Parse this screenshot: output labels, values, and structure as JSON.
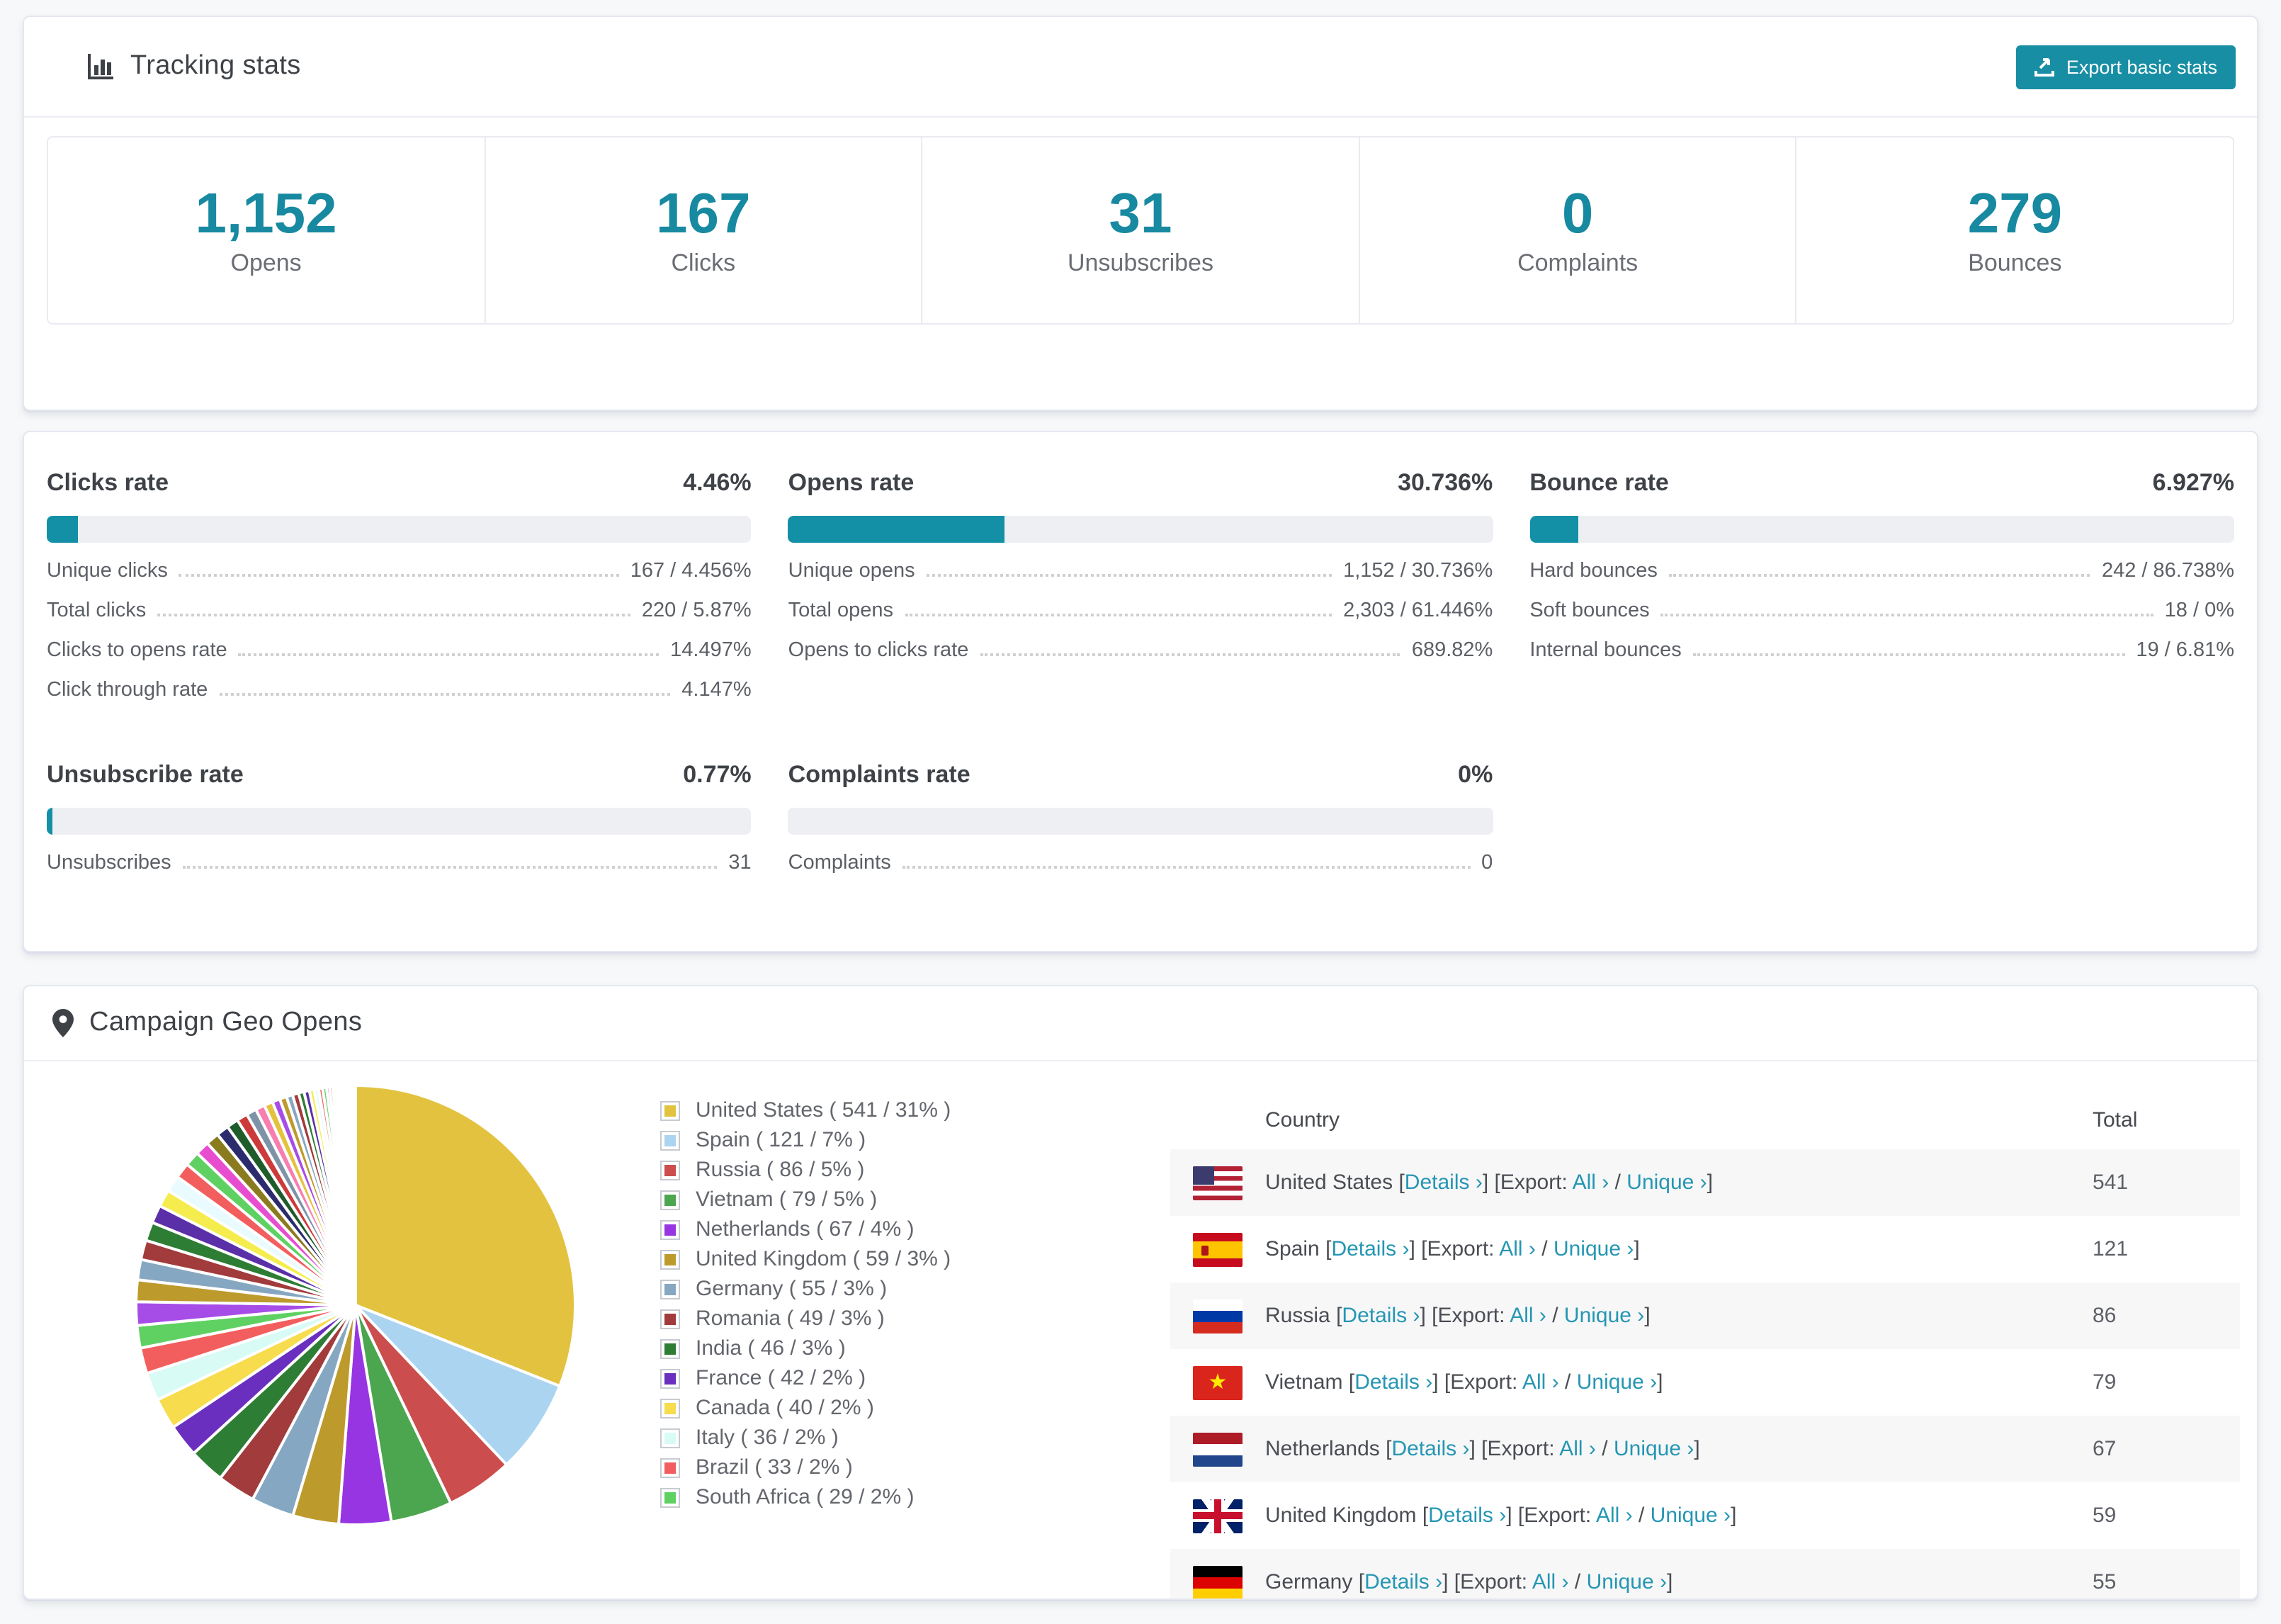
{
  "colors": {
    "accent_teal": "#178EA3",
    "number_teal": "#1789A0",
    "link_teal": "#2596B3",
    "bar_fill": "#1390A6",
    "bar_track": "#edeff3",
    "row_stripe": "#f7f7f8"
  },
  "tracking": {
    "title": "Tracking stats",
    "export_button": "Export basic stats",
    "stats": [
      {
        "value": "1,152",
        "label": "Opens"
      },
      {
        "value": "167",
        "label": "Clicks"
      },
      {
        "value": "31",
        "label": "Unsubscribes"
      },
      {
        "value": "0",
        "label": "Complaints"
      },
      {
        "value": "279",
        "label": "Bounces"
      }
    ]
  },
  "rates": [
    {
      "id": "clicks-rate",
      "title": "Clicks rate",
      "value": "4.46%",
      "pct": 4.46,
      "rows": [
        [
          "Unique clicks",
          "167 / 4.456%"
        ],
        [
          "Total clicks",
          "220 / 5.87%"
        ],
        [
          "Clicks to opens rate",
          "14.497%"
        ],
        [
          "Click through rate",
          "4.147%"
        ]
      ]
    },
    {
      "id": "opens-rate",
      "title": "Opens rate",
      "value": "30.736%",
      "pct": 30.736,
      "rows": [
        [
          "Unique opens",
          "1,152 / 30.736%"
        ],
        [
          "Total opens",
          "2,303 / 61.446%"
        ],
        [
          "Opens to clicks rate",
          "689.82%"
        ]
      ]
    },
    {
      "id": "bounce-rate",
      "title": "Bounce rate",
      "value": "6.927%",
      "pct": 6.927,
      "rows": [
        [
          "Hard bounces",
          "242 / 86.738%"
        ],
        [
          "Soft bounces",
          "18 / 0%"
        ],
        [
          "Internal bounces",
          "19 / 6.81%"
        ]
      ]
    },
    {
      "id": "unsubscribe-rate",
      "title": "Unsubscribe rate",
      "value": "0.77%",
      "pct": 0.77,
      "rows": [
        [
          "Unsubscribes",
          "31"
        ]
      ]
    },
    {
      "id": "complaints-rate",
      "title": "Complaints rate",
      "value": "0%",
      "pct": 0,
      "rows": [
        [
          "Complaints",
          "0"
        ]
      ]
    }
  ],
  "geo": {
    "title": "Campaign Geo Opens",
    "table_headers": {
      "country": "Country",
      "total": "Total"
    },
    "link_labels": {
      "details": "Details",
      "export": "Export:",
      "all": "All",
      "unique": "Unique",
      "chevron": "›"
    },
    "rows": [
      {
        "country": "United States",
        "total": "541",
        "flag": "us"
      },
      {
        "country": "Spain",
        "total": "121",
        "flag": "es"
      },
      {
        "country": "Russia",
        "total": "86",
        "flag": "ru"
      },
      {
        "country": "Vietnam",
        "total": "79",
        "flag": "vn"
      },
      {
        "country": "Netherlands",
        "total": "67",
        "flag": "nl"
      },
      {
        "country": "United Kingdom",
        "total": "59",
        "flag": "gb"
      },
      {
        "country": "Germany",
        "total": "55",
        "flag": "de"
      }
    ]
  },
  "chart_data": {
    "type": "pie",
    "title": "Campaign Geo Opens",
    "legend_position": "right",
    "categories": [
      "United States",
      "Spain",
      "Russia",
      "Vietnam",
      "Netherlands",
      "United Kingdom",
      "Germany",
      "Romania",
      "India",
      "France",
      "Canada",
      "Italy",
      "Brazil",
      "South Africa"
    ],
    "values": [
      541,
      121,
      86,
      79,
      67,
      59,
      55,
      49,
      46,
      42,
      40,
      36,
      33,
      29
    ],
    "percent_labels": [
      "31%",
      "7%",
      "5%",
      "5%",
      "4%",
      "3%",
      "3%",
      "3%",
      "3%",
      "2%",
      "2%",
      "2%",
      "2%",
      "2%"
    ],
    "colors": [
      "#E3C23F",
      "#ABD4F0",
      "#CB4D4D",
      "#4CA54F",
      "#9735E2",
      "#BD9A2C",
      "#86A7C1",
      "#A23B3B",
      "#2E7D34",
      "#6A2FBF",
      "#F7DC4D",
      "#D9FBF5",
      "#F25E5E",
      "#5FD163"
    ],
    "others_values": [
      30,
      28,
      26,
      25,
      24,
      23,
      22,
      21,
      20,
      19,
      18,
      17,
      16,
      15,
      14,
      13,
      12,
      11,
      10,
      9,
      8,
      8,
      7,
      7,
      6,
      6,
      5,
      5,
      4,
      4,
      3,
      3,
      3,
      2,
      2,
      2,
      2,
      1,
      1,
      1,
      1,
      1,
      1,
      1,
      1,
      1,
      1,
      1,
      1
    ],
    "others_palette": [
      "#A64DE8",
      "#BD9A2C",
      "#86A7C1",
      "#A23B3B",
      "#2E7D34",
      "#5B2FA8",
      "#F5ED4D",
      "#EAFBFF",
      "#F25E5E",
      "#5FD163",
      "#E84DD0",
      "#8A7B1E",
      "#2B2B6E",
      "#1E5C2A",
      "#CC3A3A",
      "#7E93A8",
      "#F77EB0",
      "#E3C23F"
    ]
  }
}
